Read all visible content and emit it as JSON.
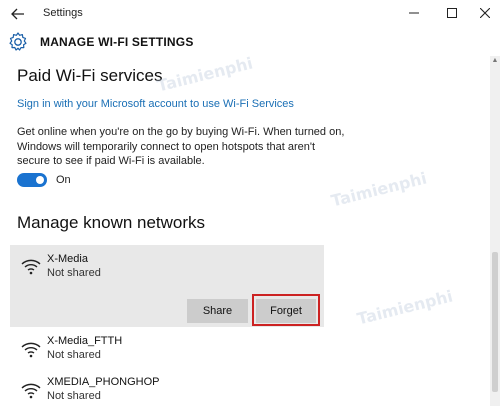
{
  "titlebar": {
    "title": "Settings",
    "back_icon": "back-arrow-icon",
    "controls": [
      "minimize-icon",
      "maximize-icon",
      "close-icon"
    ]
  },
  "header": {
    "icon": "gear-icon",
    "title": "MANAGE WI-FI SETTINGS"
  },
  "paid_wifi": {
    "heading": "Paid Wi-Fi services",
    "link": "Sign in with your Microsoft account to use Wi-Fi Services",
    "description": "Get online when you're on the go by buying Wi-Fi. When turned on, Windows will temporarily connect to open hotspots that aren't secure to see if paid Wi-Fi is available.",
    "toggle_state": "On",
    "toggle_on": true
  },
  "known_networks": {
    "heading": "Manage known networks",
    "networks": [
      {
        "name": "X-Media",
        "status": "Not shared",
        "selected": true
      },
      {
        "name": "X-Media_FTTH",
        "status": "Not shared",
        "selected": false
      },
      {
        "name": "XMEDIA_PHONGHOP",
        "status": "Not shared",
        "selected": false
      }
    ],
    "share_label": "Share",
    "forget_label": "Forget"
  },
  "watermark": "Taimienphi",
  "colors": {
    "accent": "#1a73d0",
    "link": "#1a6fb5",
    "highlight_border": "#cc2222",
    "selected_bg": "#e8e8e8",
    "button_bg": "#cccccc"
  }
}
